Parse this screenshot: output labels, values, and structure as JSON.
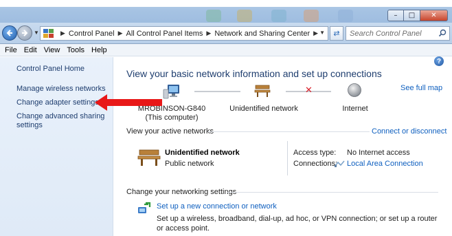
{
  "window": {
    "controls": {
      "minimize": "–",
      "maximize": "□",
      "close": "✕"
    }
  },
  "navigation": {
    "back_icon": "back-arrow-icon",
    "forward_icon": "forward-arrow-icon",
    "breadcrumbs": [
      "Control Panel",
      "Control Panel Items",
      "Network and Sharing Center"
    ],
    "breadcrumb_prefix": "All",
    "search_placeholder": "Search Control Panel"
  },
  "menubar": {
    "items": [
      "File",
      "Edit",
      "View",
      "Tools",
      "Help"
    ]
  },
  "sidebar": {
    "home": "Control Panel Home",
    "links": [
      "Manage wireless networks",
      "Change adapter settings",
      "Change advanced sharing",
      "settings"
    ]
  },
  "main": {
    "title": "View your basic network information and set up connections",
    "see_full_map": "See full map",
    "map": {
      "computer_name": "MROBINSON-G840",
      "computer_note": "(This computer)",
      "network": "Unidentified network",
      "internet": "Internet"
    },
    "active_networks": {
      "heading": "View your active networks",
      "connect_link": "Connect or disconnect",
      "network_name": "Unidentified network",
      "network_category": "Public network",
      "access_type_label": "Access type:",
      "access_type_value": "No Internet access",
      "connections_label": "Connections:",
      "connections_value": "Local Area Connection"
    },
    "settings": {
      "heading": "Change your networking settings",
      "setup_link": "Set up a new connection or network",
      "setup_desc": "Set up a wireless, broadband, dial-up, ad hoc, or VPN connection; or set up a router or access point."
    }
  },
  "colors": {
    "link": "#0e5fbf",
    "heading": "#1e3d6e",
    "annotation_arrow": "#e81818",
    "error_x": "#d8202a"
  }
}
